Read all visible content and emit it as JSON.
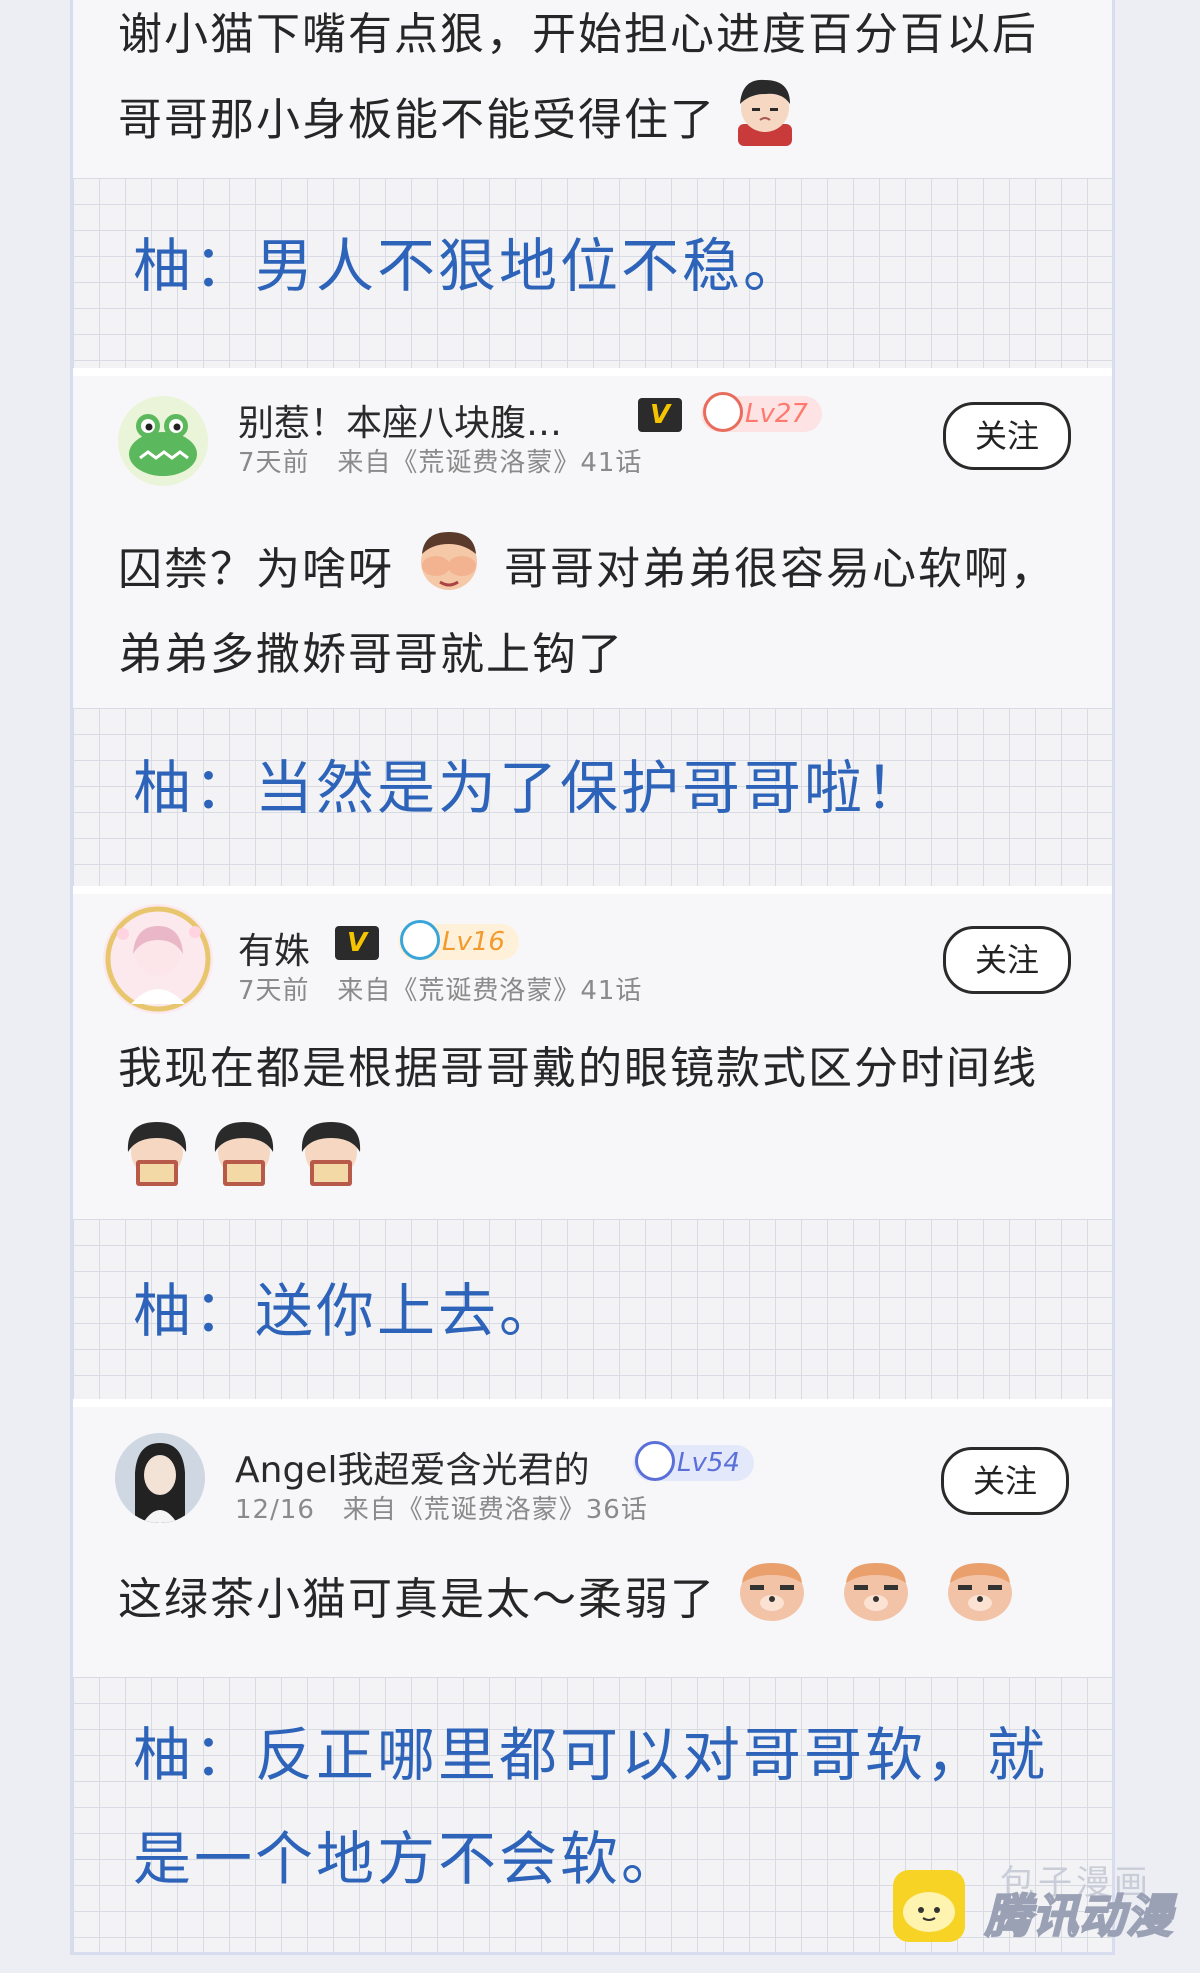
{
  "top": {
    "line1": "谢小猫下嘴有点狠，开始担心进度百分百以后",
    "line2": "哥哥那小身板能不能受得住了",
    "reply": "柚：男人不狠地位不稳。"
  },
  "comments": [
    {
      "username": "别惹！本座八块腹…",
      "time": "7天前",
      "source": "来自《荒诞费洛蒙》41话",
      "level": "Lv27",
      "level_color": "#ff7a6e",
      "follow_label": "关注",
      "text_line1_a": "囚禁？为啥呀",
      "text_line1_b": "哥哥对弟弟很容易心软啊，",
      "text_line2": "弟弟多撒娇哥哥就上钩了",
      "reply": "柚：当然是为了保护哥哥啦！"
    },
    {
      "username": "有姝",
      "time": "7天前",
      "source": "来自《荒诞费洛蒙》41话",
      "level": "Lv16",
      "level_color": "#f29a2e",
      "follow_label": "关注",
      "text_line1": "我现在都是根据哥哥戴的眼镜款式区分时间线",
      "reply": "柚：送你上去。"
    },
    {
      "username": "Angel我超爱含光君的",
      "time": "12/16",
      "source": "来自《荒诞费洛蒙》36话",
      "level": "Lv54",
      "level_color": "#5a6fd8",
      "follow_label": "关注",
      "text_line1": "这绿茶小猫可真是太～柔弱了",
      "reply_line1": "柚：反正哪里都可以对哥哥软，就",
      "reply_line2": "是一个地方不会软。"
    }
  ],
  "watermark": {
    "main": "腾讯动漫",
    "sub": "包子漫画"
  },
  "colors": {
    "reply_blue": "#2d63b8",
    "vip_gold": "#f5c400"
  }
}
